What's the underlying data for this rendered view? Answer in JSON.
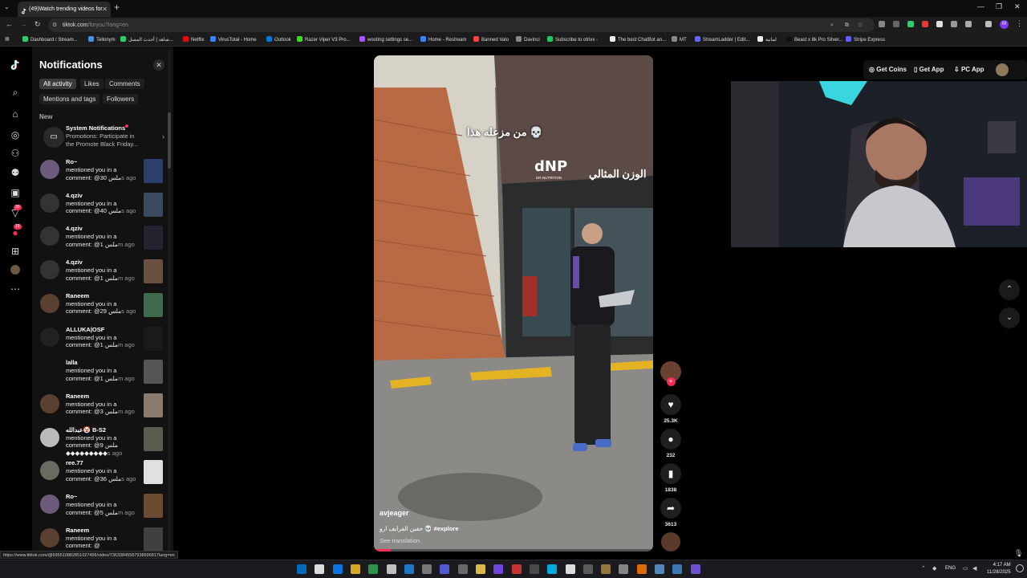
{
  "browser": {
    "tab_title": "(49)Watch trending videos for",
    "address": "tiktok.com",
    "address_path": "/foryou?lang=en",
    "status_url": "https://www.tiktok.com/@695510882851027456/video/73633845587938696817lang=en"
  },
  "bookmarks": [
    {
      "label": "Dashboard / Stream...",
      "color": "#2ecc71"
    },
    {
      "label": "Tellonym",
      "color": "#4a90e2"
    },
    {
      "label": "شاهد | أحدث المسل...",
      "color": "#2ecc71"
    },
    {
      "label": "Netflix",
      "color": "#e50914"
    },
    {
      "label": "VirusTotal - Home",
      "color": "#3b82f6"
    },
    {
      "label": "Outlook",
      "color": "#0078d4"
    },
    {
      "label": "Razer Viper V3 Pro...",
      "color": "#44d62c"
    },
    {
      "label": "wooting settings se...",
      "color": "#a855f7"
    },
    {
      "label": "Home - Restream",
      "color": "#3b82f6"
    },
    {
      "label": "Banned Valo",
      "color": "#ef4444"
    },
    {
      "label": "Davinci",
      "color": "#888888"
    },
    {
      "label": "Subscribe to otrixx -",
      "color": "#22c55e"
    },
    {
      "label": "The best ChatBot an...",
      "color": "#eeeeee"
    },
    {
      "label": "MT",
      "color": "#888888"
    },
    {
      "label": "StreamLadder | Edit...",
      "color": "#6366f1"
    },
    {
      "label": "لمانية",
      "color": "#eeeeee"
    },
    {
      "label": "Beast x 8k Pro Silver...",
      "color": "#111111"
    },
    {
      "label": "Stripe Express",
      "color": "#635bff"
    }
  ],
  "rail": {
    "badge_inbox": "30",
    "badge_activity": "19"
  },
  "notifications": {
    "title": "Notifications",
    "tabs": [
      "All activity",
      "Likes",
      "Comments",
      "Mentions and tags",
      "Followers"
    ],
    "section_label": "New",
    "system": {
      "name": "System Notifications",
      "text": "Promotions: Participate in the Promote Black Friday..."
    },
    "items": [
      {
        "name": "Ro~",
        "text": "mentioned you in a comment: @30 ملس",
        "time": "s ago",
        "av": "#6b5a7a",
        "th": "#2a3f6a"
      },
      {
        "name": "4.qziv",
        "text": "mentioned you in a comment: @40 ملس",
        "time": "s ago",
        "av": "#333333",
        "th": "#3a4a60"
      },
      {
        "name": "4.qziv",
        "text": "mentioned you in a comment: @1 ملس",
        "time": "m ago",
        "av": "#333333",
        "th": "#242430"
      },
      {
        "name": "4.qziv",
        "text": "mentioned you in a comment: @1 ملس",
        "time": "m ago",
        "av": "#333333",
        "th": "#6a5040"
      },
      {
        "name": "Raneem",
        "text": "mentioned you in a comment: @29 ملس",
        "time": "s ago",
        "av": "#5a4030",
        "th": "#3d6a50"
      },
      {
        "name": "ALLUKA|OSF",
        "text": "mentioned you in a comment: @1 ملس",
        "time": "m ago",
        "av": "#222222",
        "th": "#1a1a1a"
      },
      {
        "name": "lalla",
        "text": "mentioned you in a comment: @1 ملس",
        "time": "m ago",
        "av": "#121212",
        "th": "#555555"
      },
      {
        "name": "Raneem",
        "text": "mentioned you in a comment: @3 ملس",
        "time": "m ago",
        "av": "#5a4030",
        "th": "#8a7a70"
      },
      {
        "name": "عبدالله🤡 B-S2",
        "text": "mentioned you in a comment: @ملس 9 ◆◆◆◆◆◆◆◆◆",
        "time": "s ago",
        "av": "#bbbbbb",
        "th": "#5a5a50"
      },
      {
        "name": "ree.77",
        "text": "mentioned you in a comment: @36 ملس",
        "time": "s ago",
        "av": "#6a6a60",
        "th": "#e0e0e0"
      },
      {
        "name": "Ro~",
        "text": "mentioned you in a comment: @5 ملس",
        "time": "m ago",
        "av": "#6b5a7a",
        "th": "#6a4a30"
      },
      {
        "name": "Raneem",
        "text": "mentioned you in a comment: @",
        "time": "",
        "av": "#5a4030",
        "th": "#404040"
      }
    ]
  },
  "header": {
    "get_coins": "Get Coins",
    "get_app": "Get App",
    "pc_app": "PC App"
  },
  "video": {
    "username": "avjeager",
    "caption_text": "حقين الفرايف ارو 💀",
    "caption_tag": "#explore",
    "see_translation": "See translation",
    "overlay_text": "من مزعله هذا 💀",
    "progress": 0.06,
    "sign_brand": "dNP",
    "sign_sub": "DR.NUTRITION",
    "sign_arabic": "الوزن المثالي"
  },
  "actions": {
    "likes": "25.3K",
    "comments": "232",
    "saves": "1838",
    "shares": "3613"
  },
  "taskbar": {
    "lang": "ENG",
    "time": "4:17 AM",
    "date": "11/28/2025"
  }
}
